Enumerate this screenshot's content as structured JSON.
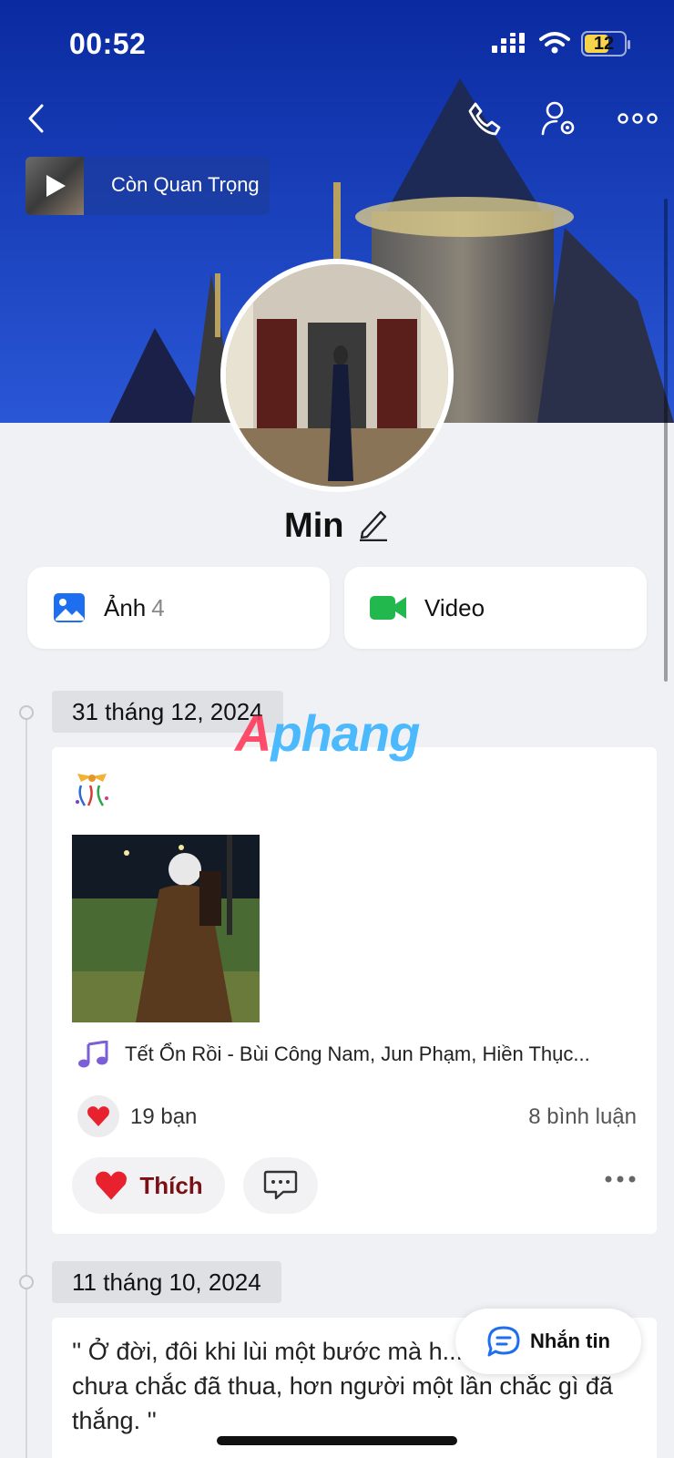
{
  "status_bar": {
    "time": "00:52",
    "battery": "12"
  },
  "music": {
    "title": "Còn Quan Trọng"
  },
  "profile": {
    "name": "Min"
  },
  "tabs": [
    {
      "label": "Ảnh",
      "count": "4"
    },
    {
      "label": "Video"
    }
  ],
  "posts": [
    {
      "date": "31 tháng 12, 2024",
      "song": "Tết Ổn Rồi - Bùi Công Nam, Jun Phạm, Hiền Thục...",
      "reactions": "19 bạn",
      "comments": "8 bình luận",
      "like_label": "Thích"
    },
    {
      "date": "11 tháng 10, 2024",
      "text": "'' Ở đời, đôi khi lùi một bước mà h... đầu một lần chưa chắc đã thua, hơn người một lần chắc gì đã thắng. ''"
    }
  ],
  "message_button": {
    "label": "Nhắn tin"
  },
  "watermark": {
    "prefix": "A",
    "rest": "phang"
  },
  "colors": {
    "cover_blue": "#1f4bd1",
    "like_red": "#7a0f14",
    "accent_blue": "#1e6ff0"
  }
}
